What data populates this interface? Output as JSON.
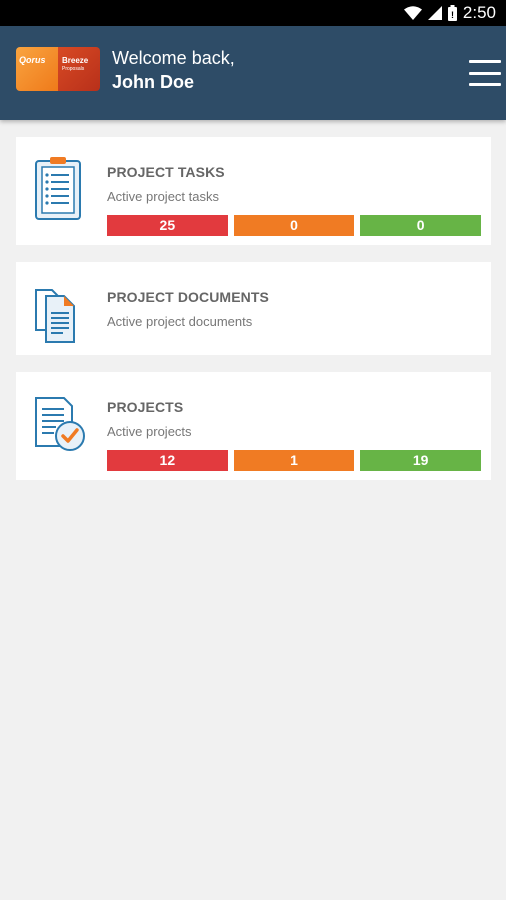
{
  "status_bar": {
    "time": "2:50",
    "icons": [
      "wifi-icon",
      "signal-icon",
      "battery-icon"
    ]
  },
  "header": {
    "logo": {
      "left_text": "Qorus",
      "right_text": "Breeze",
      "right_subtext": "Proposals"
    },
    "welcome_text": "Welcome back,",
    "user_name": "John Doe",
    "menu_icon": "hamburger-menu-icon",
    "background": "#2e4c67"
  },
  "cards": [
    {
      "title": "PROJECT TASKS",
      "subtitle": "Active project tasks",
      "counts": [
        "25",
        "0",
        "0"
      ],
      "icon": "clipboard-checklist-icon"
    },
    {
      "title": "PROJECT DOCUMENTS",
      "subtitle": "Active project documents",
      "icon": "documents-icon"
    },
    {
      "title": "PROJECTS",
      "subtitle": "Active projects",
      "counts": [
        "12",
        "1",
        "19"
      ],
      "icon": "document-check-icon"
    }
  ],
  "status_colors": {
    "red": "#e23a3e",
    "orange": "#f07b23",
    "green": "#67b446"
  }
}
